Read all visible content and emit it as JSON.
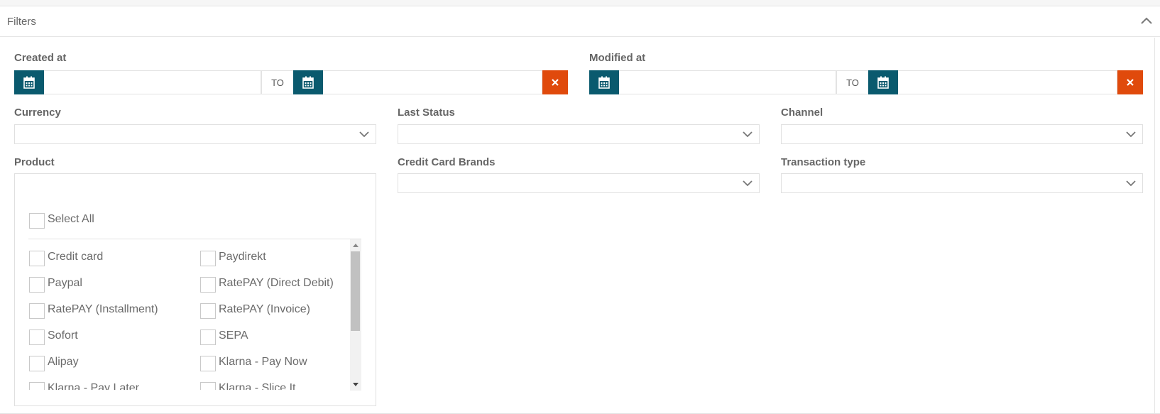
{
  "filters": {
    "title": "Filters",
    "created_at": {
      "label": "Created at",
      "to_label": "TO"
    },
    "modified_at": {
      "label": "Modified at",
      "to_label": "TO"
    },
    "currency": {
      "label": "Currency",
      "value": ""
    },
    "last_status": {
      "label": "Last Status",
      "value": ""
    },
    "channel": {
      "label": "Channel",
      "value": ""
    },
    "product": {
      "label": "Product",
      "value": "",
      "select_all": "Select All",
      "options": [
        "Credit card",
        "Paydirekt",
        "Paypal",
        "RatePAY (Direct Debit)",
        "RatePAY (Installment)",
        "RatePAY (Invoice)",
        "Sofort",
        "SEPA",
        "Alipay",
        "Klarna - Pay Now",
        "Klarna - Pay Later",
        "Klarna - Slice It"
      ]
    },
    "credit_card_brands": {
      "label": "Credit Card Brands",
      "value": ""
    },
    "transaction_type": {
      "label": "Transaction type",
      "value": ""
    }
  },
  "colors": {
    "accent": "#0a5a6e",
    "danger": "#e04a0c"
  },
  "icons": {
    "calendar": "calendar-icon",
    "clear": "close-icon",
    "chevron": "chevron-down-icon"
  }
}
